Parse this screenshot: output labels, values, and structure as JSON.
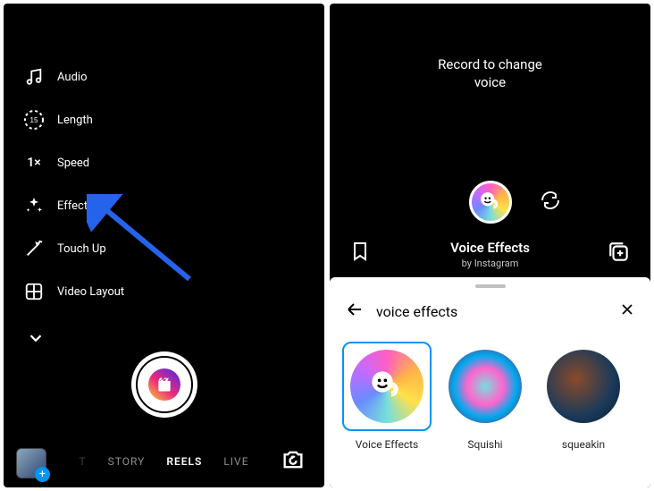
{
  "left": {
    "tools": {
      "audio": "Audio",
      "length": "Length",
      "length_value": "15",
      "speed": "Speed",
      "speed_value": "1×",
      "effects": "Effects",
      "touchup": "Touch Up",
      "layout": "Video Layout"
    },
    "tabs": {
      "t0": "T",
      "story": "STORY",
      "reels": "REELS",
      "live": "LIVE"
    }
  },
  "right": {
    "record_msg_line1": "Record to change",
    "record_msg_line2": "voice",
    "effect_name": "Voice Effects",
    "effect_by": "by Instagram",
    "search_query": "voice effects",
    "fx": {
      "a": "Voice Effects",
      "b": "Squishi",
      "c": "squeakin"
    }
  }
}
